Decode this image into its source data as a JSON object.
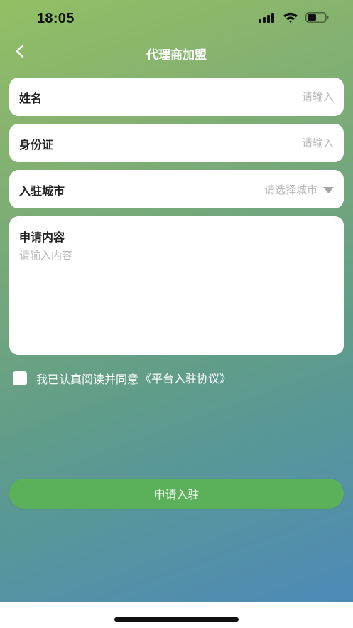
{
  "status_bar": {
    "time": "18:05",
    "icons": [
      "cellular-signal-icon",
      "wifi-icon",
      "battery-icon"
    ]
  },
  "nav": {
    "back_icon": "chevron-left-icon",
    "title": "代理商加盟"
  },
  "form": {
    "name": {
      "label": "姓名",
      "placeholder": "请输入",
      "value": ""
    },
    "id_card": {
      "label": "身份证",
      "placeholder": "请输入",
      "value": ""
    },
    "city": {
      "label": "入驻城市",
      "placeholder": "请选择城市",
      "dropdown_icon": "caret-down-icon"
    },
    "content": {
      "label": "申请内容",
      "placeholder": "请输入内容",
      "value": ""
    }
  },
  "agreement": {
    "checked": false,
    "text": "我已认真阅读并同意",
    "link": "《平台入驻协议》"
  },
  "submit": {
    "label": "申请入驻"
  },
  "colors": {
    "gradient_start": "#93bf64",
    "gradient_end": "#4d8ab8",
    "button": "#5bb15a",
    "placeholder": "#b9b9b9"
  }
}
